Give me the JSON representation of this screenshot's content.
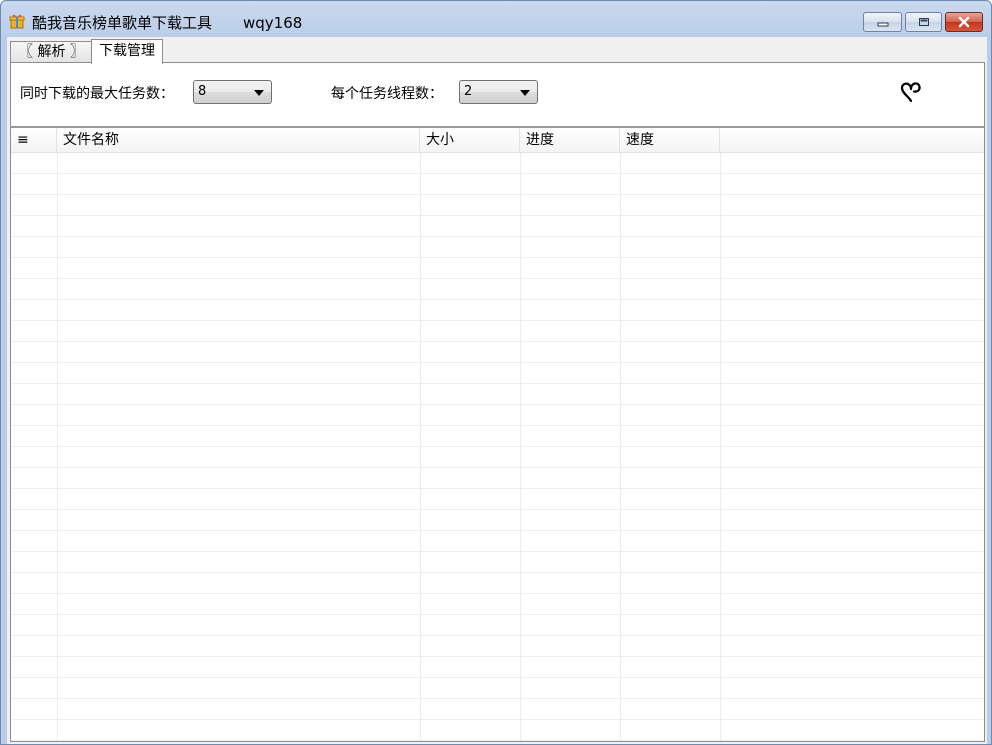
{
  "window": {
    "title": "酷我音乐榜单歌单下载工具",
    "title_extra": "wqy168",
    "controls": [
      "minimize",
      "maximize",
      "close"
    ],
    "icons": {
      "app": "gift-box-icon",
      "minimize": "minimize-icon",
      "maximize": "maximize-icon",
      "close": "close-icon"
    }
  },
  "tabs": [
    {
      "label": "〖 解析 〗",
      "active": false
    },
    {
      "label": "下载管理",
      "active": true
    }
  ],
  "settings": {
    "max_tasks_label": "同时下载的最大任务数：",
    "max_tasks_value": "8",
    "threads_label": "每个任务线程数：",
    "threads_value": "2",
    "corner_icon": "heart-icon"
  },
  "table": {
    "columns": [
      "≡",
      "文件名称",
      "大小",
      "进度",
      "速度",
      ""
    ],
    "rows": []
  },
  "colors": {
    "title_bar": "#b9cde8",
    "close_button": "#c3361e",
    "panel_bg": "#ffffff",
    "gridline": "#eeeeee"
  }
}
